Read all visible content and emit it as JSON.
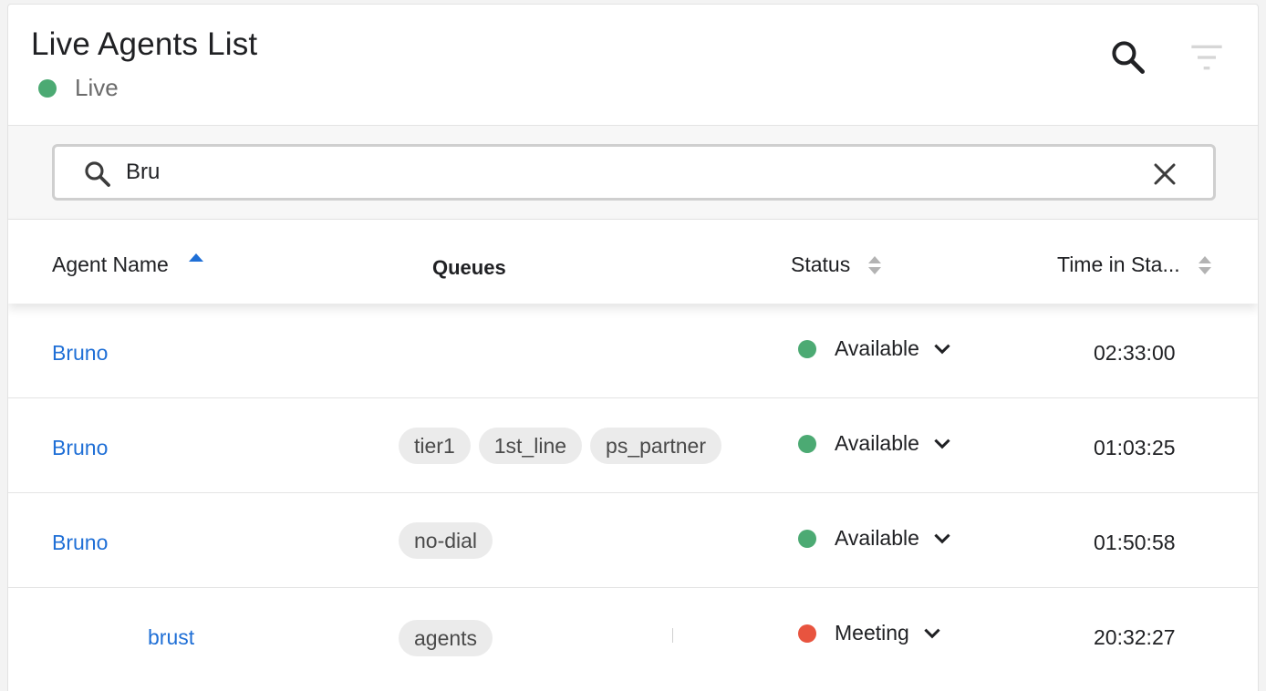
{
  "header": {
    "title": "Live Agents List",
    "live_label": "Live",
    "live_color": "#4caa73",
    "search_icon": "search-icon",
    "filter_icon": "filter-icon"
  },
  "search": {
    "value": "Bru",
    "placeholder": ""
  },
  "columns": {
    "agent_name": "Agent Name",
    "queues": "Queues",
    "status": "Status",
    "time_in_status": "Time in Sta..."
  },
  "sort": {
    "column": "agent_name",
    "direction": "ascending"
  },
  "rows": [
    {
      "agent": "Bruno",
      "queues": [],
      "status": "Available",
      "status_color": "#4caa73",
      "time": "02:33:00"
    },
    {
      "agent": "Bruno",
      "queues": [
        "tier1",
        "1st_line",
        "ps_partner"
      ],
      "status": "Available",
      "status_color": "#4caa73",
      "time": "01:03:25"
    },
    {
      "agent": "Bruno",
      "queues": [
        "no-dial"
      ],
      "status": "Available",
      "status_color": "#4caa73",
      "time": "01:50:58"
    },
    {
      "agent": "brust",
      "queues": [
        "agents"
      ],
      "status": "Meeting",
      "status_color": "#e8543f",
      "time": "20:32:27"
    }
  ]
}
